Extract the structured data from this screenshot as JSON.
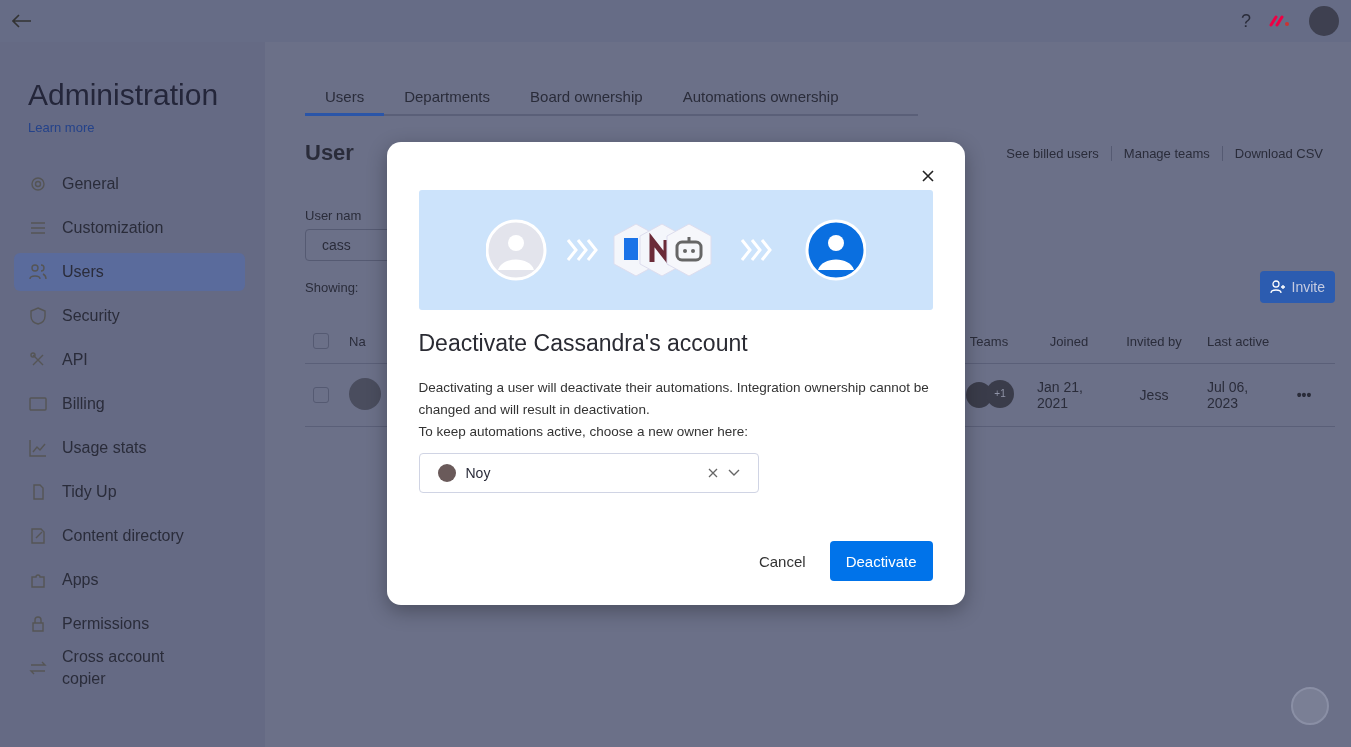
{
  "topbar": {
    "help": "?"
  },
  "sidebar": {
    "title": "Administration",
    "learn_more": "Learn more",
    "items": [
      {
        "label": "General",
        "selected": false
      },
      {
        "label": "Customization",
        "selected": false
      },
      {
        "label": "Users",
        "selected": true
      },
      {
        "label": "Security",
        "selected": false
      },
      {
        "label": "API",
        "selected": false
      },
      {
        "label": "Billing",
        "selected": false
      },
      {
        "label": "Usage stats",
        "selected": false
      },
      {
        "label": "Tidy Up",
        "selected": false
      },
      {
        "label": "Content directory",
        "selected": false
      },
      {
        "label": "Apps",
        "selected": false
      },
      {
        "label": "Permissions",
        "selected": false
      },
      {
        "label": "Cross account copier",
        "selected": false
      }
    ]
  },
  "tabs": [
    {
      "label": "Users",
      "selected": true
    },
    {
      "label": "Departments",
      "selected": false
    },
    {
      "label": "Board ownership",
      "selected": false
    },
    {
      "label": "Automations ownership",
      "selected": false
    }
  ],
  "heading": "User",
  "links": [
    "See billed users",
    "Manage teams",
    "Download CSV"
  ],
  "filter": {
    "label": "User nam",
    "value": "cass"
  },
  "showing": "Showing:",
  "invite_button": "Invite",
  "table": {
    "select_all_checked": false,
    "columns": [
      "Na",
      "Teams",
      "Joined",
      "Invited by",
      "Last active"
    ],
    "rows": [
      {
        "checked": false,
        "teams_more": "+1",
        "joined": "Jan 21, 2021",
        "invited_by": "Jess",
        "last_active": "Jul 06, 2023",
        "menu": "•••"
      }
    ]
  },
  "modal": {
    "title": "Deactivate Cassandra's account",
    "body": [
      "Deactivating a user will deactivate their automations. Integration ownership cannot be changed and will result in deactivation.",
      "To keep automations active, choose a new owner here:"
    ],
    "owner_select": {
      "value": "Noy"
    },
    "buttons": {
      "cancel": "Cancel",
      "confirm": "Deactivate"
    }
  }
}
